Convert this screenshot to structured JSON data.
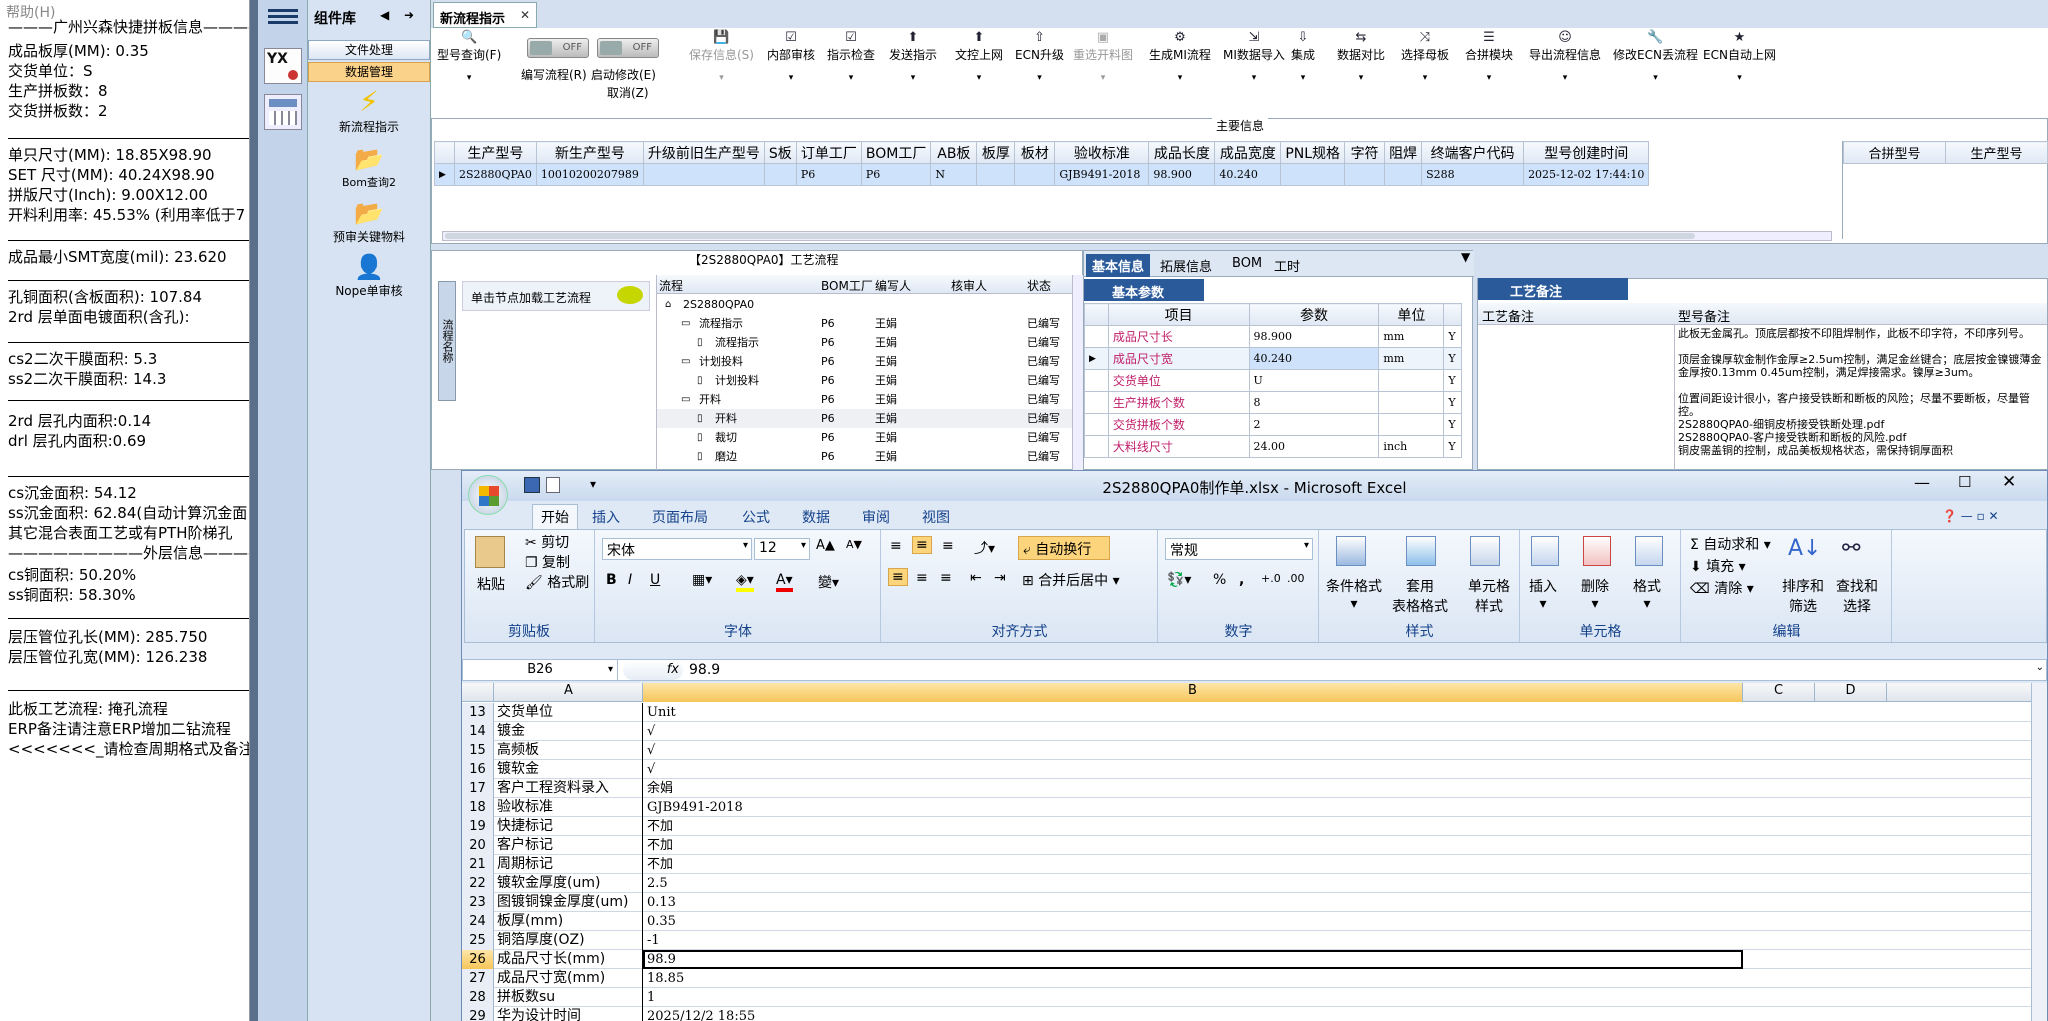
{
  "left_panel": {
    "menu": "帮助(H)",
    "lines": [
      "———广州兴森快捷拼板信息————",
      "成品板厚(MM): 0.35",
      "交货单位：S",
      "生产拼板数：8",
      "交货拼板数：2",
      "单只尺寸(MM): 18.85X98.90",
      "SET 尺寸(MM): 40.24X98.90",
      "拼版尺寸(Inch): 9.00X12.00",
      "开料利用率: 45.53% (利用率低于7",
      "成品最小SMT宽度(mil): 23.620",
      "孔铜面积(含板面积): 107.84",
      "2rd        层单面电镀面积(含孔):",
      "cs2二次干膜面积: 5.3",
      "ss2二次干膜面积: 14.3",
      "2rd            层孔内面积:0.14",
      "drl            层孔内面积:0.69",
      "cs沉金面积: 54.12",
      "ss沉金面积: 62.84(自动计算沉金面",
      "其它混合表面工艺或有PTH阶梯孔",
      "—————————外层信息——————————",
      "cs铜面积: 50.20%",
      "ss铜面积: 58.30%",
      "层压管位孔长(MM): 285.750",
      "层压管位孔宽(MM): 126.238",
      "此板工艺流程:  掩孔流程",
      "ERP备注请注意ERP增加二钻流程",
      "<<<<<<<_请检查周期格式及备注"
    ]
  },
  "nav": {
    "menu_icon": "hamburger-icon",
    "yx_label": "YX",
    "calc_icon": "calculator-icon"
  },
  "components": {
    "title": "组件库",
    "sections": [
      "文件处理",
      "数据管理"
    ],
    "items": [
      "新流程指示",
      "Bom查询2",
      "预审关键物料",
      "Nope单审核"
    ]
  },
  "tab": {
    "label": "新流程指示",
    "close": "✕"
  },
  "toolbar": {
    "items": [
      {
        "label": "型号查询(F)",
        "icon": "search-icon",
        "disabled": false
      },
      {
        "label": "编写流程(R)",
        "icon": "toggle-icon",
        "disabled": false
      },
      {
        "label": "启动修改(E)",
        "icon": "toggle-icon",
        "disabled": false
      },
      {
        "label": "保存信息(S)",
        "icon": "save-icon",
        "disabled": true
      },
      {
        "label": "内部审核",
        "icon": "check-icon",
        "disabled": false
      },
      {
        "label": "指示检查",
        "icon": "check-icon",
        "disabled": false
      },
      {
        "label": "发送指示",
        "icon": "upload-icon",
        "disabled": false
      },
      {
        "label": "文控上网",
        "icon": "upload-icon",
        "disabled": false
      },
      {
        "label": "ECN升级",
        "icon": "upgrade-icon",
        "disabled": false
      },
      {
        "label": "重选开料图",
        "icon": "image-icon",
        "disabled": true
      },
      {
        "label": "生成MI流程",
        "icon": "gear-icon",
        "disabled": false
      },
      {
        "label": "MI数据导入",
        "icon": "import-icon",
        "disabled": false
      },
      {
        "label": "集成",
        "icon": "download-icon",
        "disabled": false
      },
      {
        "label": "数据对比",
        "icon": "compare-icon",
        "disabled": false
      },
      {
        "label": "选择母板",
        "icon": "shuffle-icon",
        "disabled": false
      },
      {
        "label": "合拼模块",
        "icon": "list-icon",
        "disabled": false
      },
      {
        "label": "导出流程信息",
        "icon": "smile-icon",
        "disabled": false
      },
      {
        "label": "修改ECN丢流程",
        "icon": "wrench-icon",
        "disabled": false
      },
      {
        "label": "ECN自动上网",
        "icon": "star-icon",
        "disabled": false
      }
    ],
    "toggle_off": "OFF",
    "cancel_label": "取消(Z)"
  },
  "main_info": {
    "title": "主要信息",
    "headers": [
      "生产型号",
      "新生产型号",
      "升级前旧生产型号",
      "S板",
      "订单工厂",
      "BOM工厂",
      "AB板",
      "板厚",
      "板材",
      "验收标准",
      "成品长度",
      "成品宽度",
      "PNL规格",
      "字符",
      "阻焊",
      "终端客户代码",
      "型号创建时间"
    ],
    "row": [
      "2S2880QPA0",
      "10010200207989",
      "",
      "",
      "P6",
      "P6",
      "N",
      "",
      "",
      "GJB9491-2018",
      "98.900",
      "40.240",
      "",
      "",
      "",
      "S288",
      "2025-12-02 17:44:10"
    ],
    "side_headers": [
      "合拼型号",
      "生产型号"
    ]
  },
  "process": {
    "title": "【2S2880QPA0】工艺流程",
    "side_tab": "流程名称",
    "load_hint": "单击节点加载工艺流程",
    "headers": [
      "流程",
      "BOM工厂",
      "编写人",
      "核审人",
      "状态"
    ],
    "rows": [
      {
        "name": "2S2880QPA0",
        "factory": "",
        "writer": "",
        "status": "",
        "level": 0
      },
      {
        "name": "流程指示",
        "factory": "P6",
        "writer": "王娟",
        "status": "已编写",
        "level": 1
      },
      {
        "name": "流程指示",
        "factory": "P6",
        "writer": "王娟",
        "status": "已编写",
        "level": 2
      },
      {
        "name": "计划投料",
        "factory": "P6",
        "writer": "王娟",
        "status": "已编写",
        "level": 1
      },
      {
        "name": "计划投料",
        "factory": "P6",
        "writer": "王娟",
        "status": "已编写",
        "level": 2
      },
      {
        "name": "开料",
        "factory": "P6",
        "writer": "王娟",
        "status": "已编写",
        "level": 1
      },
      {
        "name": "开料",
        "factory": "P6",
        "writer": "王娟",
        "status": "已编写",
        "level": 2
      },
      {
        "name": "裁切",
        "factory": "P6",
        "writer": "王娟",
        "status": "已编写",
        "level": 2
      },
      {
        "name": "磨边",
        "factory": "P6",
        "writer": "王娟",
        "status": "已编写",
        "level": 2
      }
    ]
  },
  "basic_info": {
    "tabs": [
      "基本信息",
      "拓展信息",
      "BOM",
      "工时"
    ],
    "subtab": "基本参数",
    "headers": [
      "项目",
      "参数",
      "单位"
    ],
    "rows": [
      {
        "item": "成品尺寸长",
        "value": "98.900",
        "unit": "mm",
        "flag": "Y"
      },
      {
        "item": "成品尺寸宽",
        "value": "40.240",
        "unit": "mm",
        "flag": "Y"
      },
      {
        "item": "交货单位",
        "value": "U",
        "unit": "",
        "flag": "Y"
      },
      {
        "item": "生产拼板个数",
        "value": "8",
        "unit": "",
        "flag": "Y"
      },
      {
        "item": "交货拼板个数",
        "value": "2",
        "unit": "",
        "flag": "Y"
      },
      {
        "item": "大料线尺寸",
        "value": "24.00",
        "unit": "inch",
        "flag": "Y"
      }
    ]
  },
  "remarks": {
    "title": "工艺备注",
    "col1": "工艺备注",
    "col2": "型号备注",
    "text": [
      "此板无金属孔。顶底层都按不印阻焊制作，此板不印字符，不印序列号。",
      "",
      "顶层金镍厚软金制作金厚≥2.5um控制，满足金丝键合；底层按金镍镀薄金金厚按0.13mm 0.45um控制，满足焊接需求。镍厚≥3um。",
      "",
      "位置间距设计很小，客户接受铁断和断板的风险；尽量不要断板，尽量管控。",
      "2S2880QPA0-细铜皮桥接受铁断处理.pdf",
      "2S2880QPA0-客户接受铁断和断板的风险.pdf",
      "铜皮需盖铜的控制，成品美板规格状态，需保持铜厚面积"
    ]
  },
  "excel": {
    "title": "2S2880QPA0制作单.xlsx - Microsoft Excel",
    "tabs": [
      "开始",
      "插入",
      "页面布局",
      "公式",
      "数据",
      "审阅",
      "视图"
    ],
    "clipboard": {
      "paste": "粘贴",
      "cut": "剪切",
      "copy": "复制",
      "format_painter": "格式刷",
      "label": "剪贴板"
    },
    "font": {
      "name": "宋体",
      "size": "12",
      "label": "字体",
      "bold": "B",
      "italic": "I",
      "underline": "U"
    },
    "alignment": {
      "wrap": "自动换行",
      "merge": "合并后居中",
      "label": "对齐方式"
    },
    "number": {
      "format": "常规",
      "percent": "%",
      "comma": ",",
      "label": "数字"
    },
    "styles": {
      "conditional": "条件格式",
      "table_format": "套用\n表格格式",
      "cell_styles": "单元格\n样式",
      "label": "样式"
    },
    "cells": {
      "insert": "插入",
      "delete": "删除",
      "format": "格式",
      "label": "单元格"
    },
    "editing": {
      "autosum": "自动求和",
      "fill": "填充",
      "clear": "清除",
      "sort": "排序和\n筛选",
      "find": "查找和\n选择",
      "label": "编辑"
    },
    "name_box": "B26",
    "fx": "fx",
    "formula": "98.9",
    "columns": [
      "A",
      "B",
      "C",
      "D"
    ],
    "rows": [
      {
        "n": "13",
        "a": "交货单位",
        "b": "Unit"
      },
      {
        "n": "14",
        "a": "镀金",
        "b": "√"
      },
      {
        "n": "15",
        "a": "高频板",
        "b": "√"
      },
      {
        "n": "16",
        "a": "镀软金",
        "b": "√"
      },
      {
        "n": "17",
        "a": "客户工程资料录入",
        "b": "余娟"
      },
      {
        "n": "18",
        "a": "验收标准",
        "b": "GJB9491-2018"
      },
      {
        "n": "19",
        "a": "快捷标记",
        "b": "不加"
      },
      {
        "n": "20",
        "a": "客户标记",
        "b": "不加"
      },
      {
        "n": "21",
        "a": "周期标记",
        "b": "不加"
      },
      {
        "n": "22",
        "a": "镀软金厚度(um)",
        "b": "2.5"
      },
      {
        "n": "23",
        "a": "图镀铜镍金厚度(um)",
        "b": "0.13"
      },
      {
        "n": "24",
        "a": "板厚(mm)",
        "b": "0.35"
      },
      {
        "n": "25",
        "a": "铜箔厚度(OZ)",
        "b": "-1"
      },
      {
        "n": "26",
        "a": "成品尺寸长(mm)",
        "b": "98.9"
      },
      {
        "n": "27",
        "a": "成品尺寸宽(mm)",
        "b": "18.85"
      },
      {
        "n": "28",
        "a": "拼板数su",
        "b": "1"
      },
      {
        "n": "29",
        "a": "华为设计时间",
        "b": "2025/12/2 18:55"
      }
    ]
  }
}
